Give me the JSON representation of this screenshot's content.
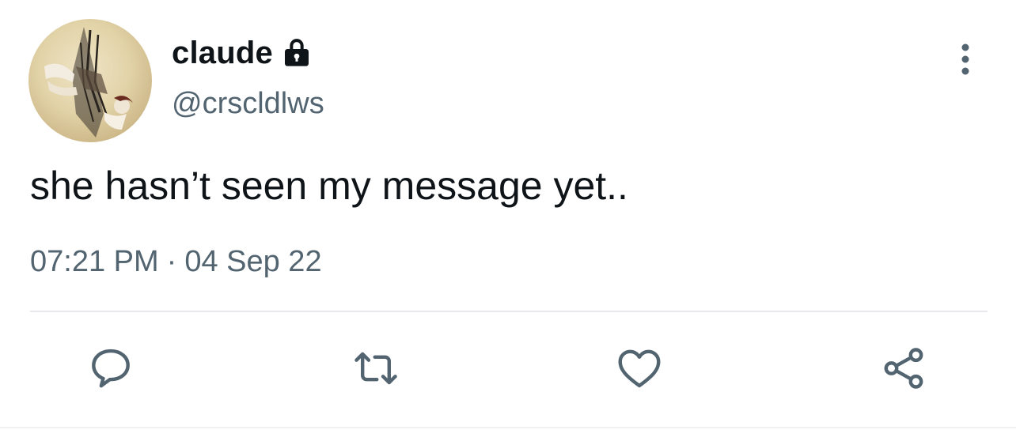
{
  "author": {
    "display_name": "claude",
    "handle": "@crscldlws",
    "protected": true
  },
  "tweet": {
    "text": "she hasn’t seen my message yet..",
    "time": "07:21 PM",
    "separator": "·",
    "date": "04 Sep 22"
  },
  "actions": [
    "reply-icon",
    "retweet-icon",
    "like-icon",
    "share-icon"
  ],
  "colors": {
    "text_primary": "#0f1419",
    "text_secondary": "#536471",
    "icon": "#536471",
    "divider": "#e7e9ec"
  }
}
